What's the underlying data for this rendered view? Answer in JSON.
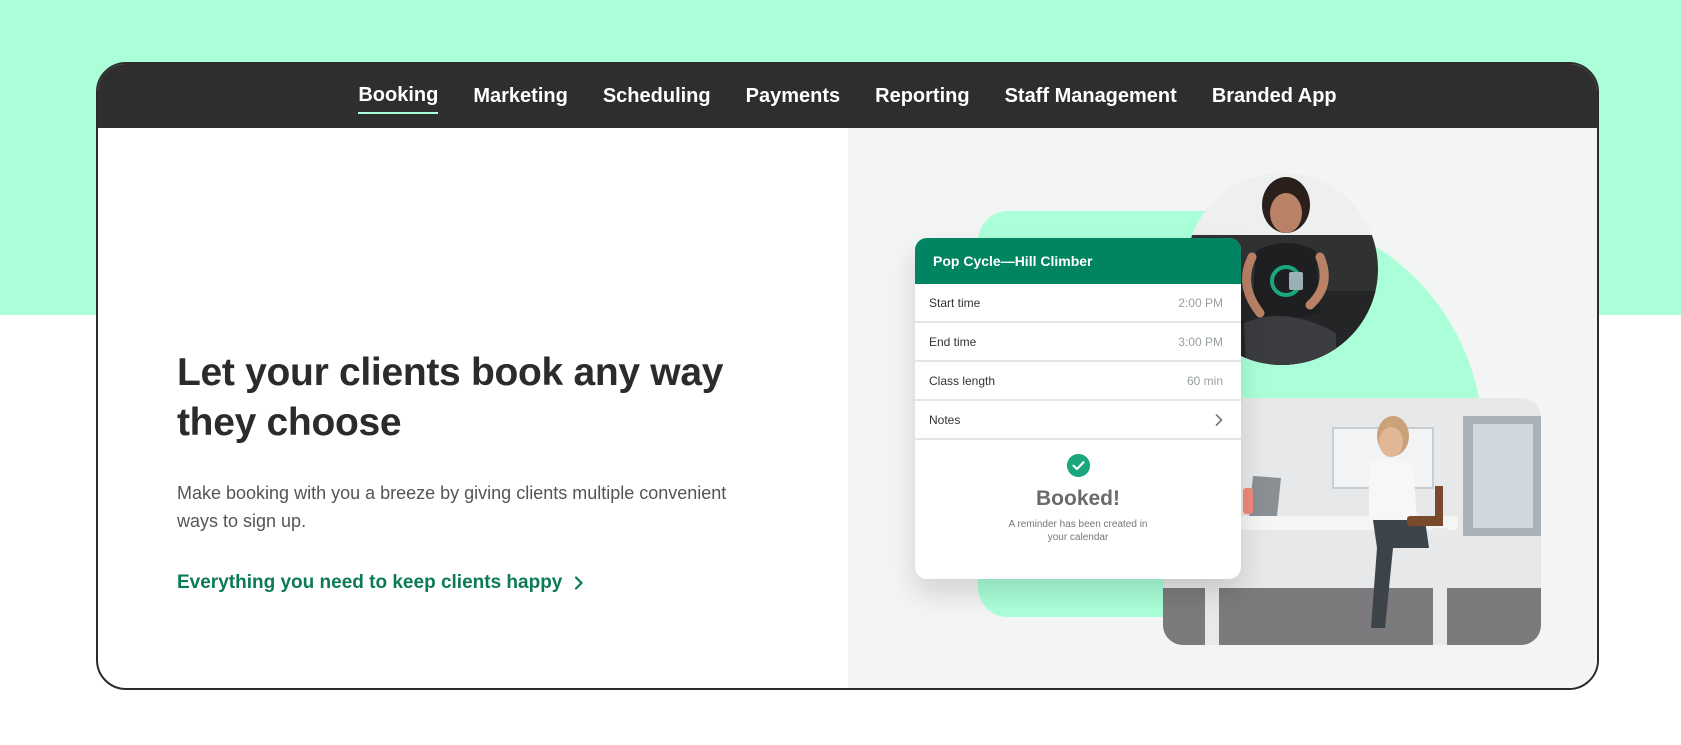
{
  "colors": {
    "mint": "#aaffd9",
    "nav_bg": "#2e2e2e",
    "brand_green": "#008462",
    "cta_green": "#0b7a55",
    "headline": "#2b2b2b",
    "panel_bg": "#f3f4f4"
  },
  "nav": {
    "active_tab": "Booking",
    "tabs": [
      {
        "label": "Booking"
      },
      {
        "label": "Marketing"
      },
      {
        "label": "Scheduling"
      },
      {
        "label": "Payments"
      },
      {
        "label": "Reporting"
      },
      {
        "label": "Staff Management"
      },
      {
        "label": "Branded App"
      }
    ]
  },
  "hero": {
    "headline": "Let your clients book any way they choose",
    "subtext": "Make booking with you a breeze by giving clients multiple convenient ways to sign up.",
    "cta_label": "Everything you need to keep clients happy",
    "cta_icon": "chevron-right-icon"
  },
  "booking_card": {
    "title": "Pop Cycle—Hill Climber",
    "rows": [
      {
        "label": "Start time",
        "value": "2:00 PM"
      },
      {
        "label": "End time",
        "value": "3:00 PM"
      },
      {
        "label": "Class length",
        "value": "60 min"
      },
      {
        "label": "Notes",
        "value": "",
        "icon": "chevron-right-icon"
      }
    ],
    "status_icon": "check-circle-icon",
    "status": "Booked!",
    "status_note": "A reminder has been created in your calendar"
  }
}
